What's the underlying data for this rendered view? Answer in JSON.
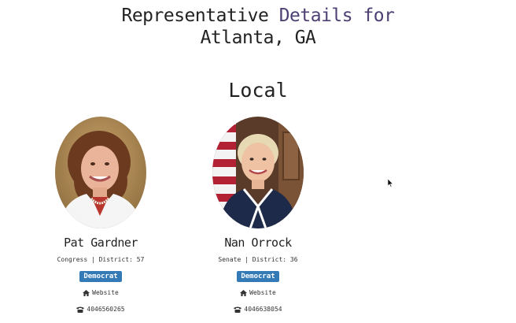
{
  "header": {
    "title_prefix": "Representative ",
    "title_accent": "Details for",
    "title_location": "Atlanta, GA"
  },
  "section": {
    "heading": "Local"
  },
  "representatives": [
    {
      "name": "Pat Gardner",
      "office": "Congress | District: 57",
      "party": "Democrat",
      "website_label": "Website",
      "phone": "4046560265",
      "photo_icon": "portrait-photo"
    },
    {
      "name": "Nan Orrock",
      "office": "Senate | District: 36",
      "party": "Democrat",
      "website_label": "Website",
      "phone": "4046638054",
      "photo_icon": "portrait-photo"
    }
  ],
  "icons": {
    "website": "home-icon",
    "phone": "phone-icon",
    "cursor": "mouse-pointer-icon"
  },
  "colors": {
    "accent": "#4d3f73",
    "party_badge": "#337ab7",
    "text": "#222222"
  }
}
